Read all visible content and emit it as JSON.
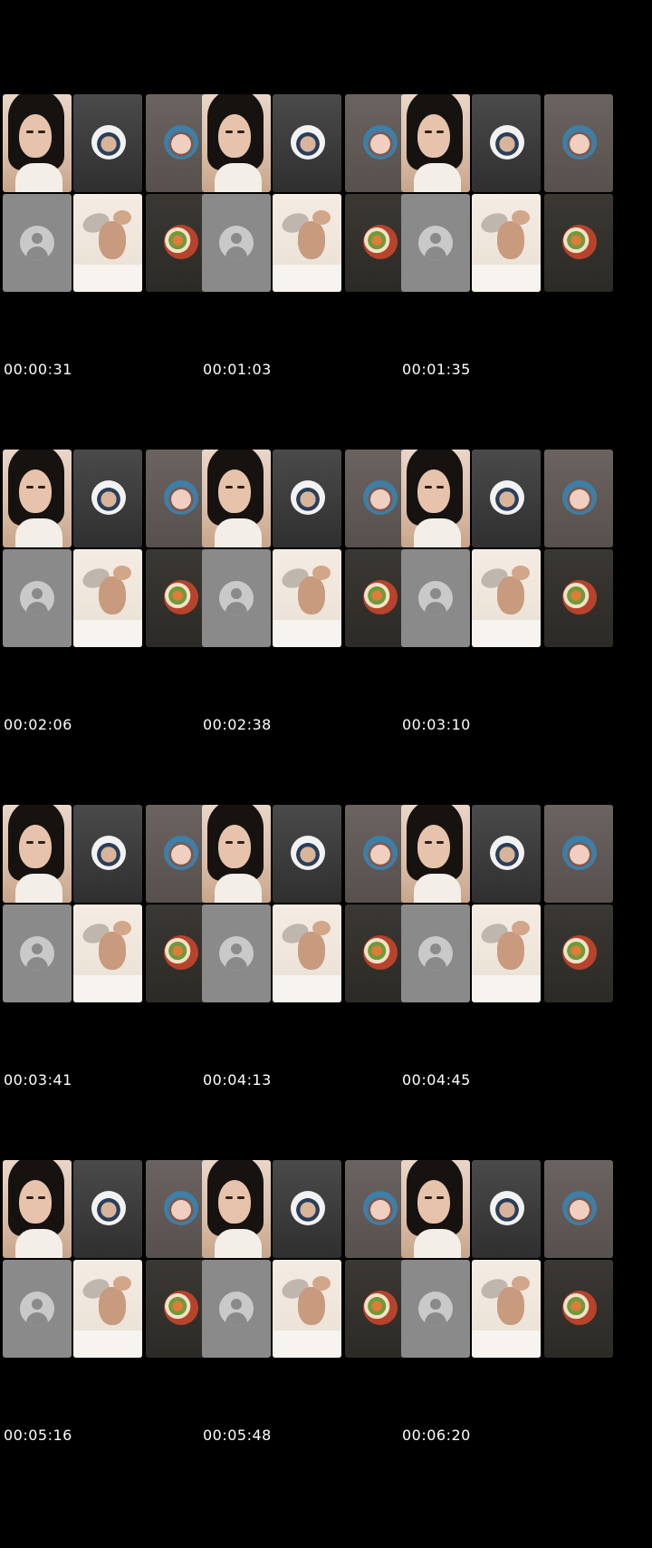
{
  "frames": [
    {
      "time": "00:00:31"
    },
    {
      "time": "00:01:03"
    },
    {
      "time": "00:01:35"
    },
    {
      "time": "00:02:06"
    },
    {
      "time": "00:02:38"
    },
    {
      "time": "00:03:10"
    },
    {
      "time": "00:03:41"
    },
    {
      "time": "00:04:13"
    },
    {
      "time": "00:04:45"
    },
    {
      "time": "00:05:16"
    },
    {
      "time": "00:05:48"
    },
    {
      "time": "00:06:20"
    }
  ],
  "tiles": [
    {
      "kind": "video",
      "icon": "selfie-woman"
    },
    {
      "kind": "avatar",
      "icon": "man-avatar-circle"
    },
    {
      "kind": "avatar",
      "icon": "woman-avatar-circle"
    },
    {
      "kind": "placeholder",
      "icon": "default-user-icon"
    },
    {
      "kind": "video",
      "icon": "man-lying-video"
    },
    {
      "kind": "avatar",
      "icon": "food-avatar-circle"
    }
  ],
  "colors": {
    "background": "#000000",
    "timestamp": "#ffffff",
    "placeholder_tile": "#8a8a8a"
  }
}
